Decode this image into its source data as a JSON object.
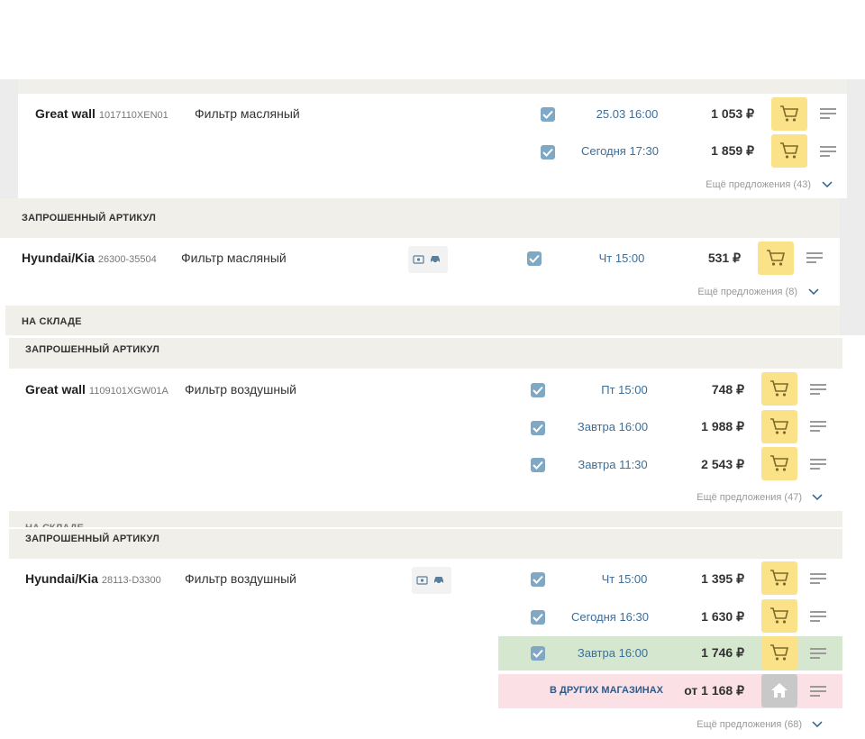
{
  "prices": [
    {
      "brand": "Great wall",
      "code": "1017110XEN01",
      "name": "Фильтр масляный",
      "offers": [
        {
          "date": "25.03 16:00",
          "price": "1 053 ₽"
        },
        {
          "date": "Сегодня 17:30",
          "price": "1 859 ₽"
        }
      ],
      "more": "Ещё предложения (43)"
    },
    {
      "section": "ЗАПРОШЕННЫЙ АРТИКУЛ",
      "brand": "Hyundai/Kia",
      "code": "26300-35504",
      "name": "Фильтр масляный",
      "offers": [
        {
          "date": "Чт 15:00",
          "price": "531 ₽"
        }
      ],
      "more": "Ещё предложения (8)",
      "after": "НА СКЛАДЕ"
    },
    {
      "section": "ЗАПРОШЕННЫЙ АРТИКУЛ",
      "brand": "Great wall",
      "code": "1109101XGW01A",
      "name": "Фильтр воздушный",
      "offers": [
        {
          "date": "Пт 15:00",
          "price": "748 ₽"
        },
        {
          "date": "Завтра 16:00",
          "price": "1 988 ₽"
        },
        {
          "date": "Завтра 11:30",
          "price": "2 543 ₽"
        }
      ],
      "more": "Ещё предложения (47)",
      "after": "НА СКЛАДЕ"
    },
    {
      "section": "ЗАПРОШЕННЫЙ АРТИКУЛ",
      "brand": "Hyundai/Kia",
      "code": "28113-D3300",
      "name": "Фильтр воздушный",
      "offers": [
        {
          "date": "Чт 15:00",
          "price": "1 395 ₽"
        },
        {
          "date": "Сегодня 16:30",
          "price": "1 630 ₽"
        },
        {
          "date": "Завтра 16:00",
          "price": "1 746 ₽"
        }
      ],
      "other": {
        "label": "В ДРУГИХ МАГАЗИНАХ",
        "price": "от 1 168 ₽"
      },
      "more": "Ещё предложения (68)"
    }
  ],
  "colors": {
    "accent": "#fbe188",
    "highlight_green": "#d5e8cf",
    "highlight_pink": "#fbe0e6",
    "date_blue": "#3c6e9a"
  },
  "icons": {
    "checkbox": "check-icon",
    "cart": "cart-icon",
    "menu": "menu-icon",
    "home": "home-icon",
    "more": "chevron-down-icon"
  }
}
